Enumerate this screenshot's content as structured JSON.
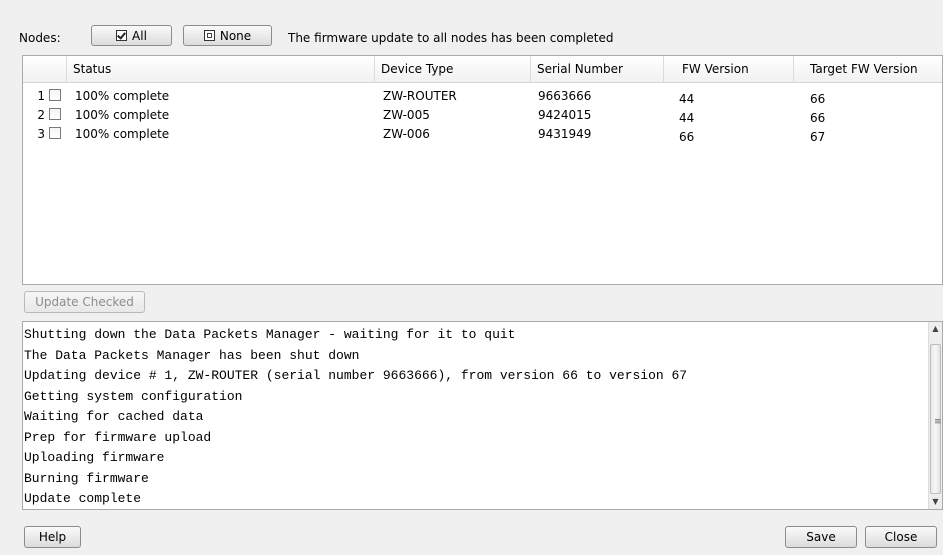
{
  "header": {
    "nodes_label": "Nodes:",
    "all_button": "All",
    "none_button": "None",
    "status_message": "The firmware update to all nodes has been completed"
  },
  "table": {
    "columns": [
      "Status",
      "Device Type",
      "Serial Number",
      "FW Version",
      "Target FW Version"
    ],
    "rows": [
      {
        "num": "1",
        "status": "100% complete",
        "device_type": "ZW-ROUTER",
        "serial": "9663666",
        "fw": "44",
        "target_fw": "66"
      },
      {
        "num": "2",
        "status": "100% complete",
        "device_type": "ZW-005",
        "serial": "9424015",
        "fw": "44",
        "target_fw": "66"
      },
      {
        "num": "3",
        "status": "100% complete",
        "device_type": "ZW-006",
        "serial": "9431949",
        "fw": "66",
        "target_fw": "67"
      }
    ]
  },
  "update_checked_button": "Update Checked",
  "log": {
    "lines": [
      "Shutting down the Data Packets Manager - waiting for it to quit",
      "The Data Packets Manager has been shut down",
      "Updating device # 1, ZW-ROUTER (serial number 9663666), from version 66 to version 67",
      "Getting system configuration",
      "Waiting for cached data",
      "Prep for firmware upload",
      "Uploading firmware",
      "Burning firmware",
      "Update complete"
    ]
  },
  "footer": {
    "help_button": "Help",
    "save_button": "Save",
    "close_button": "Close"
  },
  "icons": {
    "all_icon": "checked-box-icon",
    "none_icon": "empty-box-icon",
    "scroll_up": "arrow-up-icon",
    "scroll_down": "arrow-down-icon"
  }
}
